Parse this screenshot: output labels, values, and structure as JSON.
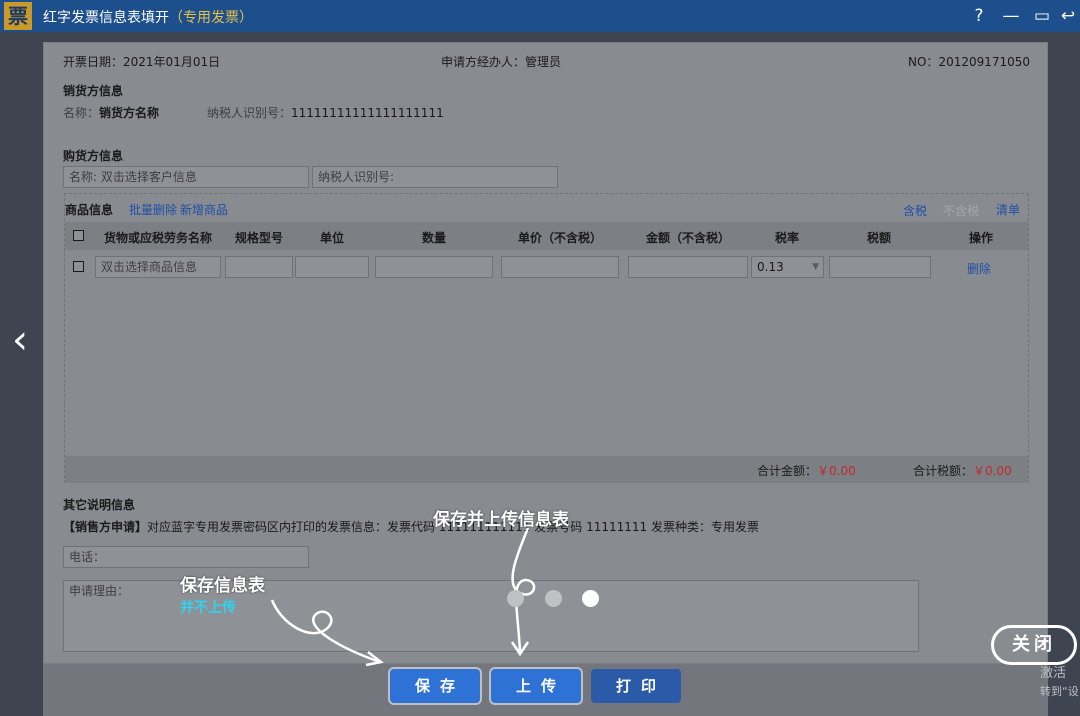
{
  "window": {
    "logo_glyph": "票",
    "title": "红字发票信息表填开",
    "subtitle": "（专用发票）",
    "help_glyph": "?",
    "minimize_glyph": "—",
    "maximize_glyph": "▭",
    "back_glyph": "↩"
  },
  "header": {
    "date_label": "开票日期：",
    "date_value": "2021年01月01日",
    "handler_label": "申请方经办人：",
    "handler_value": "管理员",
    "no_label": "NO：",
    "no_value": "201209171050"
  },
  "seller": {
    "section_title": "销货方信息",
    "name_label": "名称：",
    "name_value": "销货方名称",
    "taxid_label": "纳税人识别号：",
    "taxid_value": "11111111111111111111"
  },
  "buyer": {
    "section_title": "购货方信息",
    "name_placeholder": "名称: 双击选择客户信息",
    "taxid_placeholder": "纳税人识别号:"
  },
  "goods": {
    "section_title": "商品信息",
    "batch_delete": "批量删除",
    "add_item": "新增商品",
    "tax_included": "含税",
    "tax_excluded": "不含税",
    "list": "清单",
    "columns": [
      "货物或应税劳务名称",
      "规格型号",
      "单位",
      "数量",
      "单价（不含税）",
      "金额（不含税）",
      "税率",
      "税额",
      "操作"
    ],
    "row": {
      "name_placeholder": "双击选择商品信息",
      "tax_rate": "0.13",
      "delete": "删除"
    },
    "total_amount_label": "合计金额：",
    "total_amount_value": "￥0.00",
    "total_tax_label": "合计税额：",
    "total_tax_value": "￥0.00"
  },
  "other": {
    "section_title": "其它说明信息",
    "seller_apply_label": "【销售方申请】",
    "seller_apply_text": "对应蓝字专用发票密码区内打印的发票信息：发票代码 111111111111 发票号码 11111111 发票种类：专用发票",
    "phone_placeholder": "电话：",
    "reason_placeholder": "申请理由："
  },
  "buttons": {
    "save": "保存",
    "upload": "上传",
    "print": "打印"
  },
  "annotations": {
    "save_upload_note": "保存并上传信息表",
    "save_note": "保存信息表",
    "save_note_sub": "并不上传",
    "close": "关闭"
  },
  "watermark": {
    "line1": "激活",
    "line2": "转到“设"
  },
  "nav": {
    "prev_glyph": "‹"
  },
  "colors": {
    "titlebar": "#1d4f8d",
    "button_blue": "#2f72d6",
    "annotation_cyan": "#30d3f2",
    "total_red": "#c12a2a"
  }
}
